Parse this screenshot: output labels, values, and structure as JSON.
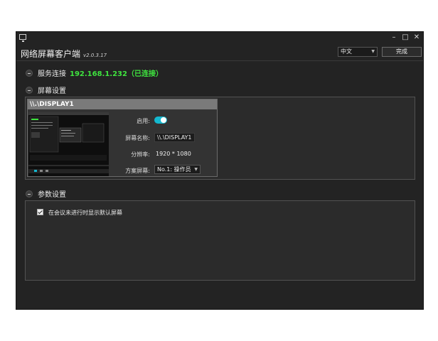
{
  "window": {
    "title": "网络屏幕客户端",
    "version": "v2.0.3.17",
    "controls": [
      "–",
      "□",
      "✕"
    ],
    "language": "中文",
    "done_label": "完成"
  },
  "server_section": {
    "label": "服务连接",
    "address": "192.168.1.232（已连接）",
    "address_color": "#3fe33f"
  },
  "screen_section": {
    "label": "屏幕设置",
    "display": {
      "header": "\\\\.\\DISPLAY1",
      "enabled_label": "启用:",
      "enabled": true,
      "name_label": "屏幕名称:",
      "name_value": "\\\\.\\DISPLAY1",
      "resolution_label": "分辨率:",
      "resolution_value": "1920 * 1080",
      "role_label": "方案屏幕:",
      "role_value": "No.1: 操作员"
    }
  },
  "param_section": {
    "label": "参数设置",
    "option_label": "在会议未进行时显示默认屏幕",
    "option_checked": true
  },
  "accent_color": "#14b8cf"
}
